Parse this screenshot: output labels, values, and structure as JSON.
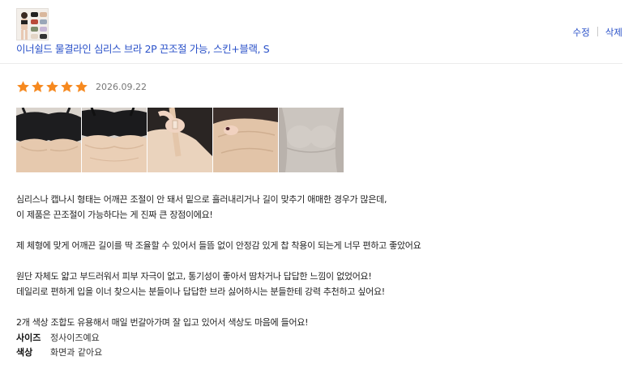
{
  "product": {
    "name": "이너쉴드 물결라인 심리스 브라 2P 끈조절 가능, 스킨+블랙, S",
    "thumbnail_icon": "product-thumbnail-image"
  },
  "actions": {
    "edit_label": "수정",
    "delete_label": "삭제"
  },
  "review": {
    "rating": 5,
    "max_rating": 5,
    "date": "2026.09.22",
    "photo_count": 5,
    "paragraphs": [
      [
        "심리스나 캡나시 형태는 어깨끈 조절이 안 돼서 밑으로 흘러내리거나 길이 맞추기 애매한 경우가 많은데,",
        "이 제품은 끈조절이 가능하다는 게 진짜 큰 장점이에요!"
      ],
      [
        "제 체형에 맞게 어깨끈 길이를 딱 조율할 수 있어서 들뜸 없이 안정감 있게 찹 착용이 되는게 너무 편하고 좋았어요"
      ],
      [
        "원단 자체도 얇고 부드러워서 피부 자극이 없고, 통기성이 좋아서 땀차거나 답답한 느낌이 없었어요!",
        "데일리로 편하게 입을 이너 찾으시는 분들이나 답답한 브라 싫어하시는 분들한테  강력 추천하고 싶어요!"
      ],
      [
        "2개 색상 조합도 유용해서 매일 번갈아가며 잘 입고 있어서 색상도 마음에 들어요!"
      ]
    ],
    "attributes": [
      {
        "key": "사이즈",
        "value": "정사이즈예요"
      },
      {
        "key": "색상",
        "value": "화면과 같아요"
      }
    ]
  },
  "colors": {
    "link": "#2b52c9",
    "star": "#f6891f",
    "date": "#777777"
  }
}
